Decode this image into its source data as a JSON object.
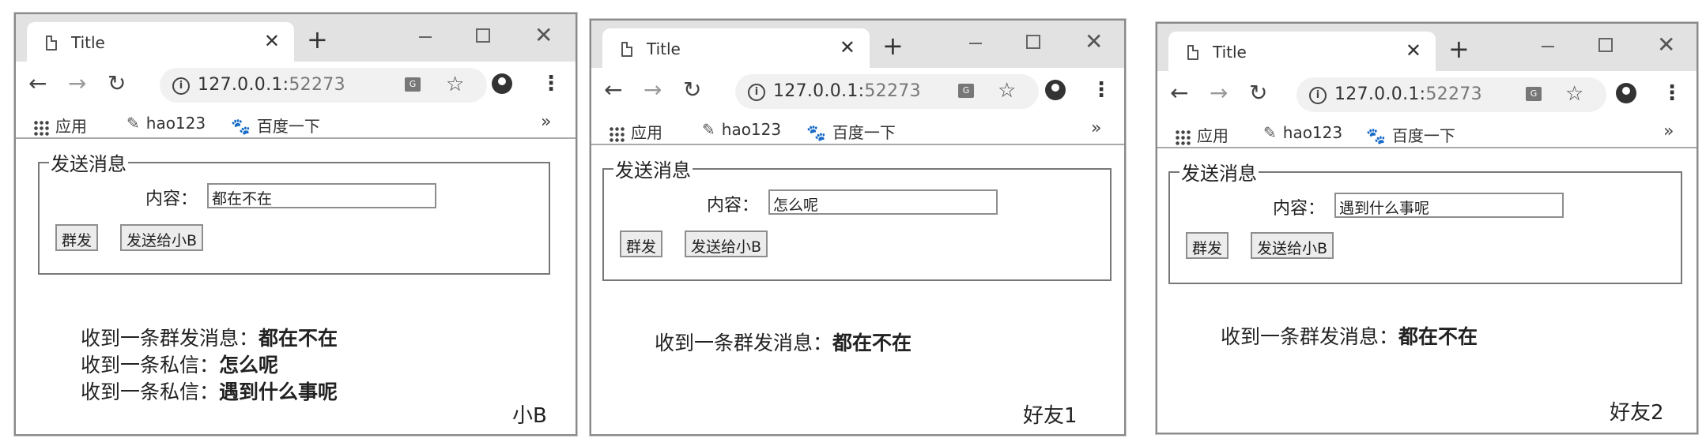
{
  "windows": [
    {
      "tab_title": "Title",
      "url_host": "127.0.0.1:",
      "url_port": "52273",
      "bookmarks": [
        "应用",
        "hao123",
        "百度一下"
      ],
      "more": "»",
      "form": {
        "legend": "发送消息",
        "content_label": "内容：",
        "content_value": "都在不在",
        "broadcast_button": "群发",
        "send_button": "发送给小B"
      },
      "messages": [
        {
          "prefix": "收到一条群发消息：",
          "text": "都在不在"
        },
        {
          "prefix": "收到一条私信：",
          "text": "怎么呢"
        },
        {
          "prefix": "收到一条私信：",
          "text": "遇到什么事呢"
        }
      ],
      "caption": "小B"
    },
    {
      "tab_title": "Title",
      "url_host": "127.0.0.1:",
      "url_port": "52273",
      "bookmarks": [
        "应用",
        "hao123",
        "百度一下"
      ],
      "more": "»",
      "form": {
        "legend": "发送消息",
        "content_label": "内容：",
        "content_value": "怎么呢",
        "broadcast_button": "群发",
        "send_button": "发送给小B"
      },
      "messages": [
        {
          "prefix": "收到一条群发消息：",
          "text": "都在不在"
        }
      ],
      "caption": "好友1"
    },
    {
      "tab_title": "Title",
      "url_host": "127.0.0.1:",
      "url_port": "52273",
      "bookmarks": [
        "应用",
        "hao123",
        "百度一下"
      ],
      "more": "»",
      "form": {
        "legend": "发送消息",
        "content_label": "内容：",
        "content_value": "遇到什么事呢",
        "broadcast_button": "群发",
        "send_button": "发送给小B"
      },
      "messages": [
        {
          "prefix": "收到一条群发消息：",
          "text": "都在不在"
        }
      ],
      "caption": "好友2"
    }
  ]
}
